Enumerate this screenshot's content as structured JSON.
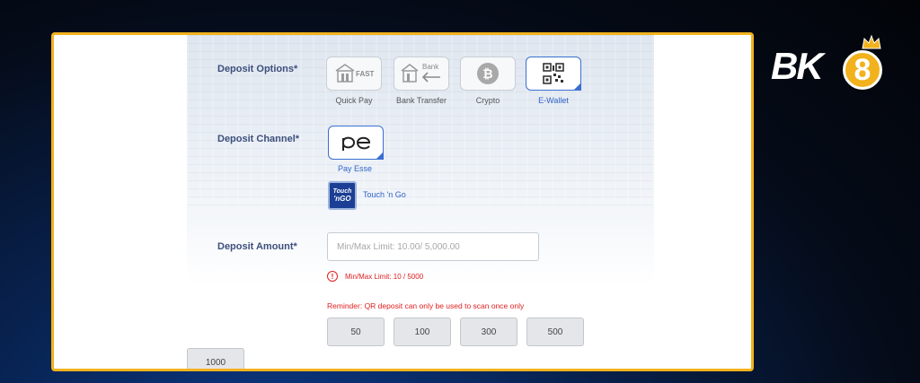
{
  "brand": {
    "logo_letters": "BK",
    "logo_number": "8",
    "accent_color": "#f2b21d"
  },
  "deposit_options": {
    "label": "Deposit Options*",
    "items": [
      {
        "label": "Quick Pay",
        "icon": "quick-pay-fast-icon",
        "icon_text": "FAST",
        "selected": false
      },
      {
        "label": "Bank Transfer",
        "icon": "bank-transfer-icon",
        "icon_text": "Bank",
        "selected": false
      },
      {
        "label": "Crypto",
        "icon": "bitcoin-icon",
        "selected": false
      },
      {
        "label": "E-Wallet",
        "icon": "qr-code-icon",
        "selected": true
      }
    ]
  },
  "deposit_channel": {
    "label": "Deposit Channel*",
    "items": [
      {
        "label": "Pay Esse",
        "icon": "pay-esse-logo",
        "selected": true
      },
      {
        "label": "Touch 'n Go",
        "icon": "touch-n-go-logo",
        "logo_text": [
          "Touch",
          "'nGO"
        ],
        "selected": false
      }
    ]
  },
  "deposit_amount": {
    "label": "Deposit Amount*",
    "placeholder": "Min/Max Limit: 10.00/ 5,000.00",
    "value": "",
    "error": "Min/Max Limit: 10 / 5000",
    "error_icon": "exclamation-icon"
  },
  "reminder": "Reminder: QR deposit can only be used to scan once only",
  "quick_amounts": [
    "50",
    "100",
    "300",
    "500",
    "1000"
  ]
}
